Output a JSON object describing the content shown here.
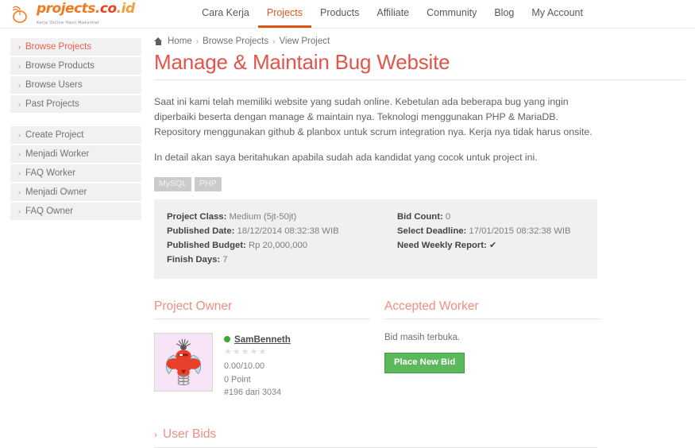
{
  "brand": {
    "word_projects": "projects",
    "word_dot": ".",
    "word_co": "co",
    "word_id": ".id",
    "tagline": "Kerja Online Hasil Maksimal"
  },
  "nav": {
    "items": [
      {
        "label": "Cara Kerja",
        "active": false
      },
      {
        "label": "Projects",
        "active": true
      },
      {
        "label": "Products",
        "active": false
      },
      {
        "label": "Affiliate",
        "active": false
      },
      {
        "label": "Community",
        "active": false
      },
      {
        "label": "Blog",
        "active": false
      },
      {
        "label": "My Account",
        "active": false
      }
    ]
  },
  "sidebar": {
    "group1": [
      {
        "label": "Browse Projects",
        "active": true
      },
      {
        "label": "Browse Products",
        "active": false
      },
      {
        "label": "Browse Users",
        "active": false
      },
      {
        "label": "Past Projects",
        "active": false
      }
    ],
    "group2": [
      {
        "label": "Create Project",
        "active": false
      },
      {
        "label": "Menjadi Worker",
        "active": false
      },
      {
        "label": "FAQ Worker",
        "active": false
      },
      {
        "label": "Menjadi Owner",
        "active": false
      },
      {
        "label": "FAQ Owner",
        "active": false
      }
    ]
  },
  "breadcrumb": {
    "home_icon": "home-icon",
    "home": "Home",
    "sep": "›",
    "level2": "Browse Projects",
    "level3": "View Project"
  },
  "project": {
    "title": "Manage & Maintain Bug Website",
    "description_p1": "Saat ini kami telah memiliki website yang sudah online. Kebetulan ada beberapa bug yang ingin diperbaiki beserta dengan manage & maintain nya. Teknologi menggunakan PHP & MariaDB. Repository menggunakan github & planbox untuk scrum integration nya. Kerja nya tidak harus onsite.",
    "description_p2": "In detail akan saya beritahukan apabila sudah ada kandidat yang cocok untuk project ini.",
    "tags": [
      "MySQL",
      "PHP"
    ],
    "info_left": [
      {
        "label": "Project Class:",
        "value": "Medium (5jt-50jt)"
      },
      {
        "label": "Published Date:",
        "value": "18/12/2014 08:32:38 WIB"
      },
      {
        "label": "Published Budget:",
        "value": "Rp 20,000,000"
      },
      {
        "label": "Finish Days:",
        "value": "7"
      }
    ],
    "info_right": [
      {
        "label": "Bid Count:",
        "value": "0"
      },
      {
        "label": "Select Deadline:",
        "value": "17/01/2015 08:32:38 WIB"
      },
      {
        "label": "Need Weekly Report:",
        "value": "✔"
      }
    ]
  },
  "owner": {
    "heading": "Project Owner",
    "avatar_icon": "bug-avatar-icon",
    "status_icon": "online-status-icon",
    "username": "SamBenneth",
    "stars": [
      "★",
      "★",
      "★",
      "★",
      "★"
    ],
    "rating": "0.00/10.00",
    "points": "0 Point",
    "rank": "#196 dari 3034"
  },
  "worker": {
    "heading": "Accepted Worker",
    "note": "Bid masih terbuka.",
    "bid_button": "Place New Bid"
  },
  "bids": {
    "chevron_icon": "chevron-right-icon",
    "title": "User Bids"
  },
  "colors": {
    "accent_orange": "#dd5513",
    "title_red": "#e2544a",
    "section_pink": "#ef8e80",
    "button_green": "#5cb85c",
    "online_green": "#3aa93a",
    "info_bg": "#f0f0f0",
    "sidebar_bg": "#f1f1f1"
  }
}
